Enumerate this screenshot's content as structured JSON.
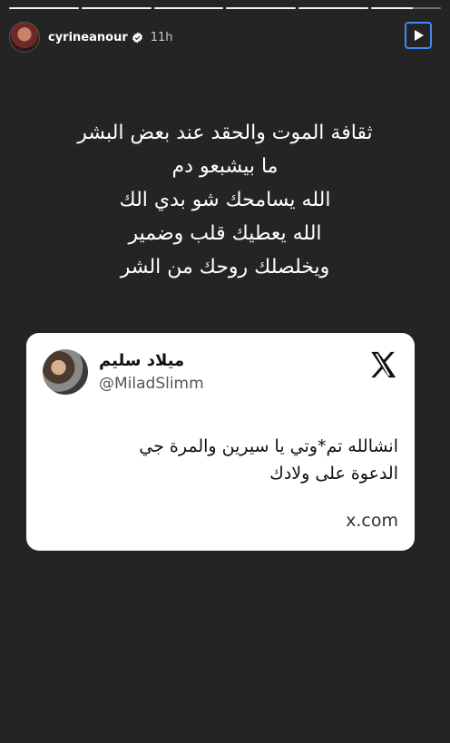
{
  "story": {
    "progress_segments": 6,
    "username": "cyrineanour",
    "time_ago": "11h"
  },
  "caption": {
    "lines": [
      "ثقافة الموت والحقد عند بعض البشر",
      "ما بيشبعو دم",
      "الله يسامحك شو بدي الك",
      "الله يعطيك قلب وضمير",
      "ويخلصلك روحك من الشر"
    ]
  },
  "tweet": {
    "display_name": "ميلاد سليم",
    "handle": "@MiladSlimm",
    "lines": [
      "انشالله تم*وتي يا سيرين والمرة جي",
      "الدعوة على ولادك"
    ],
    "domain": "x.com"
  },
  "icons": {
    "verified": "verified-badge-icon",
    "play": "play-icon",
    "more": "more-options-icon",
    "x": "x-logo-icon"
  },
  "colors": {
    "background": "#242424",
    "play_border": "#3e8bf5",
    "card": "#ffffff"
  }
}
